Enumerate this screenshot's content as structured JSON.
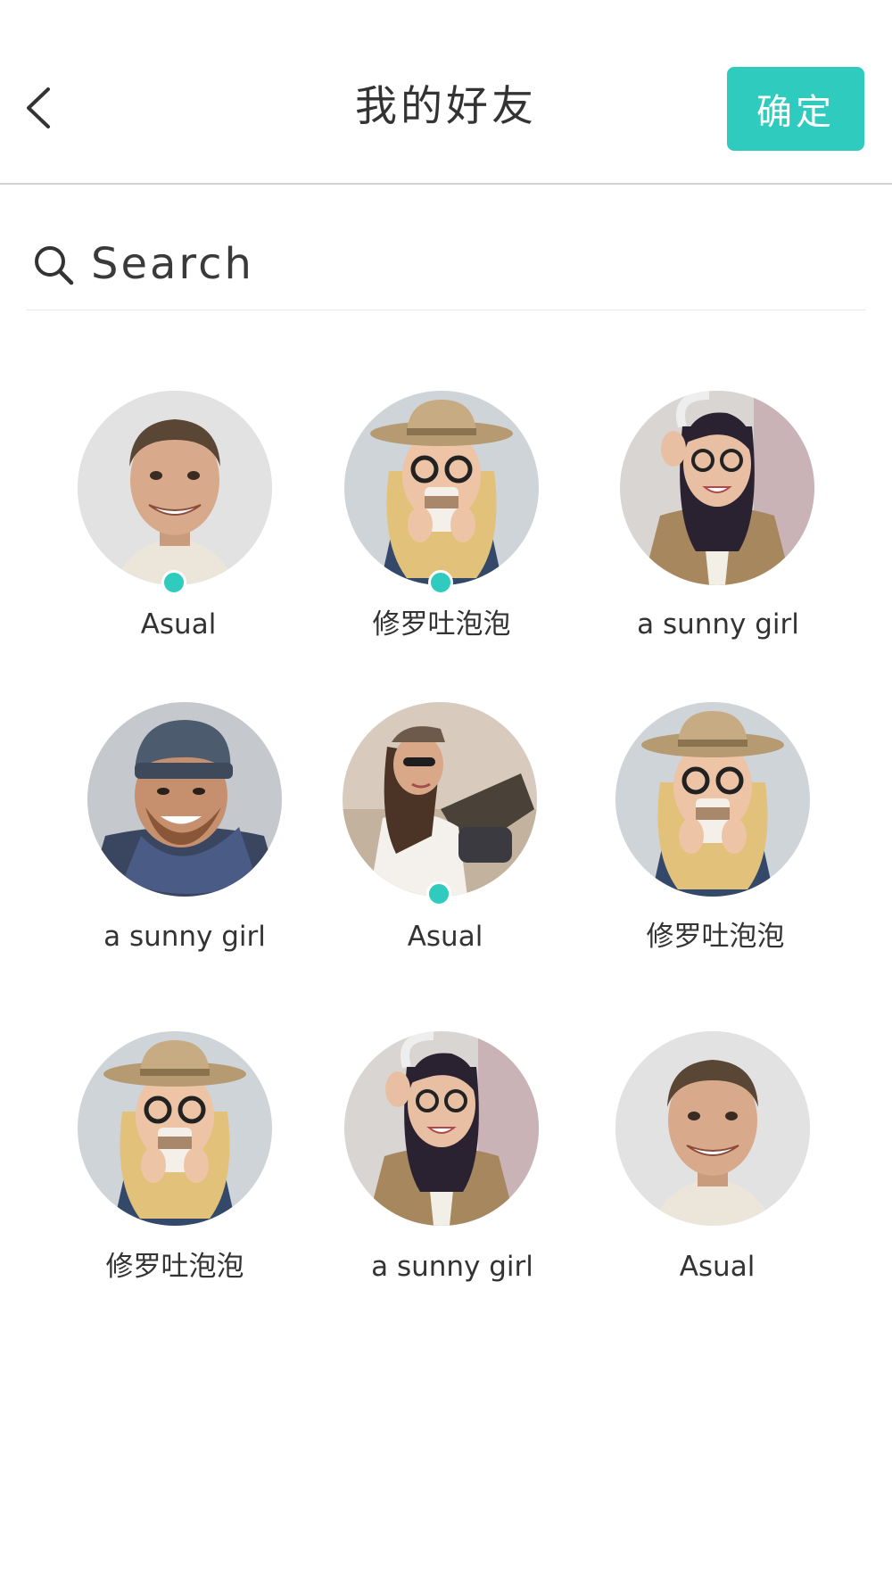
{
  "header": {
    "title": "我的好友",
    "confirm_label": "确定",
    "back_icon": "chevron-left-icon"
  },
  "search": {
    "placeholder": "Search",
    "value": "",
    "icon": "search-icon"
  },
  "colors": {
    "accent": "#2ecbbe",
    "text": "#333333",
    "divider": "#d2d2d2"
  },
  "friends": [
    {
      "name": "Asual",
      "online": true,
      "avatar": "man-smiling"
    },
    {
      "name": "修罗吐泡泡",
      "online": true,
      "avatar": "blonde-hat-coffee"
    },
    {
      "name": "a sunny girl",
      "online": false,
      "avatar": "girl-headphones-jacket"
    },
    {
      "name": "a sunny girl",
      "online": false,
      "avatar": "man-beanie-scarf"
    },
    {
      "name": "Asual",
      "online": true,
      "avatar": "girl-sunglasses-cap"
    },
    {
      "name": "修罗吐泡泡",
      "online": false,
      "avatar": "blonde-hat-coffee"
    },
    {
      "name": "修罗吐泡泡",
      "online": false,
      "avatar": "blonde-hat-coffee"
    },
    {
      "name": "a sunny girl",
      "online": false,
      "avatar": "girl-headphones-jacket"
    },
    {
      "name": "Asual",
      "online": false,
      "avatar": "man-smiling"
    }
  ]
}
